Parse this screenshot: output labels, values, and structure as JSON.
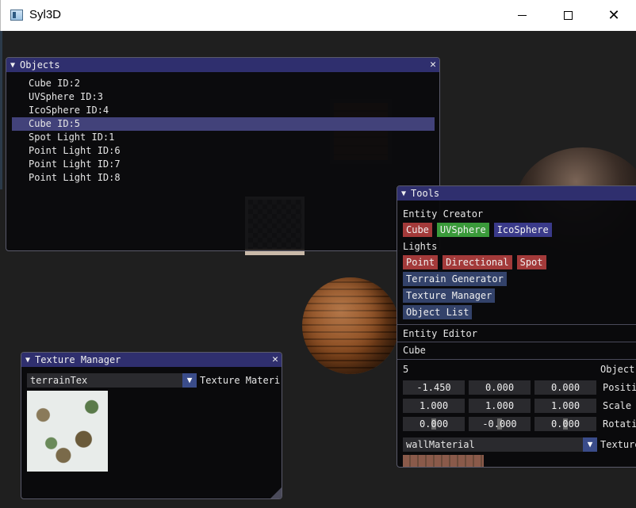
{
  "window": {
    "title": "Syl3D"
  },
  "objects_panel": {
    "title": "Objects",
    "items": [
      "Cube ID:2",
      "UVSphere ID:3",
      "IcoSphere ID:4",
      "Cube ID:5",
      "Spot Light ID:1",
      "Point Light ID:6",
      "Point Light ID:7",
      "Point Light ID:8"
    ],
    "selected": "Cube ID:5"
  },
  "tools_panel": {
    "title": "Tools",
    "entity_creator_label": "Entity Creator",
    "entity_buttons": [
      "Cube",
      "UVSphere",
      "IcoSphere"
    ],
    "lights_label": "Lights",
    "light_buttons": [
      "Point",
      "Directional",
      "Spot"
    ],
    "terrain_generator": "Terrain Generator",
    "texture_manager": "Texture Manager",
    "object_list": "Object List",
    "entity_editor_label": "Entity Editor",
    "entity_name": "Cube",
    "entity_id": "5",
    "object_label": "Object",
    "position_label": "Position",
    "scale_label": "Scale",
    "rotation_label": "Rotation",
    "position": [
      "-1.450",
      "0.000",
      "0.000"
    ],
    "scale": [
      "1.000",
      "1.000",
      "1.000"
    ],
    "rotation": [
      "0.000",
      "-0.000",
      "0.000"
    ],
    "material": "wallMaterial",
    "texture_label": "Texture"
  },
  "texture_manager_panel": {
    "title": "Texture Manager",
    "selected_texture": "terrainTex",
    "material_label": "Texture Material"
  },
  "colors": {
    "title_bar": "#2f2f6e",
    "selection": "#42427a",
    "button_red": "#a33a3a",
    "button_green": "#3a9a3a",
    "button_blue": "#3a3a8a"
  }
}
